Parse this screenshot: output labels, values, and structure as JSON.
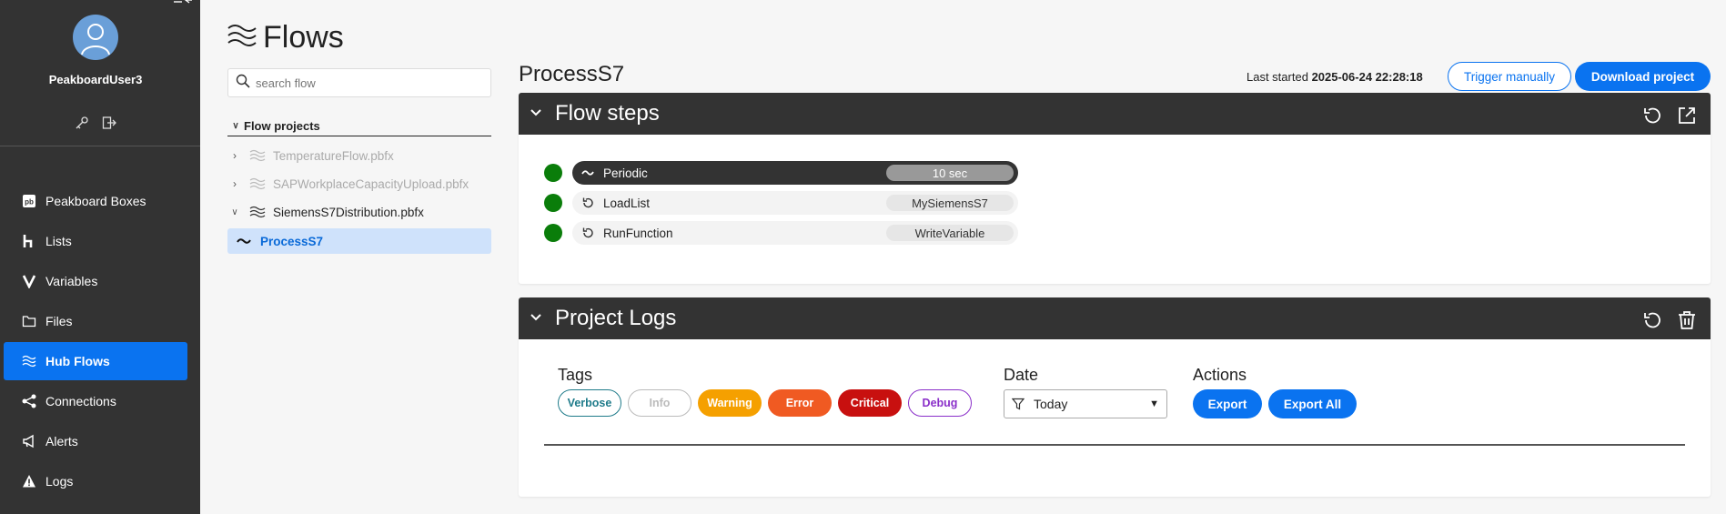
{
  "sidebar": {
    "username": "PeakboardUser3",
    "items": [
      {
        "label": "Peakboard Boxes",
        "icon": "pb-logo-icon"
      },
      {
        "label": "Lists",
        "icon": "h-icon"
      },
      {
        "label": "Variables",
        "icon": "v-icon"
      },
      {
        "label": "Files",
        "icon": "folder-icon"
      },
      {
        "label": "Hub Flows",
        "icon": "flows-icon",
        "active": true
      },
      {
        "label": "Connections",
        "icon": "share-icon"
      },
      {
        "label": "Alerts",
        "icon": "megaphone-icon"
      },
      {
        "label": "Logs",
        "icon": "warning-icon"
      }
    ]
  },
  "header": {
    "title": "Flows"
  },
  "tree": {
    "search_placeholder": "search flow",
    "heading": "Flow projects",
    "projects": [
      {
        "label": "TemperatureFlow.pbfx"
      },
      {
        "label": "SAPWorkplaceCapacityUpload.pbfx"
      },
      {
        "label": "SiemensS7Distribution.pbfx"
      }
    ],
    "selected_flow": "ProcessS7"
  },
  "main": {
    "flow_name": "ProcessS7",
    "last_started_label": "Last started",
    "last_started_value": "2025-06-24 22:28:18",
    "trigger_label": "Trigger manually",
    "download_label": "Download project",
    "steps_panel": {
      "title": "Flow steps",
      "steps": [
        {
          "name": "Periodic",
          "value": "10 sec",
          "status_color": "#0a7d0a"
        },
        {
          "name": "LoadList",
          "value": "MySiemensS7",
          "status_color": "#0a7d0a"
        },
        {
          "name": "RunFunction",
          "value": "WriteVariable",
          "status_color": "#0a7d0a"
        }
      ]
    },
    "logs_panel": {
      "title": "Project Logs",
      "tags_label": "Tags",
      "tags": [
        "Verbose",
        "Info",
        "Warning",
        "Error",
        "Critical",
        "Debug"
      ],
      "date_label": "Date",
      "date_value": "Today",
      "actions_label": "Actions",
      "export_label": "Export",
      "export_all_label": "Export All"
    }
  },
  "colors": {
    "accent": "#0a73f0",
    "sidebar": "#333333",
    "status_ok": "#0a7d0a",
    "verbose": "#1f7b8a",
    "warning": "#f5a000",
    "error": "#f05a22",
    "critical": "#c8100f",
    "debug": "#8a2fc9"
  }
}
